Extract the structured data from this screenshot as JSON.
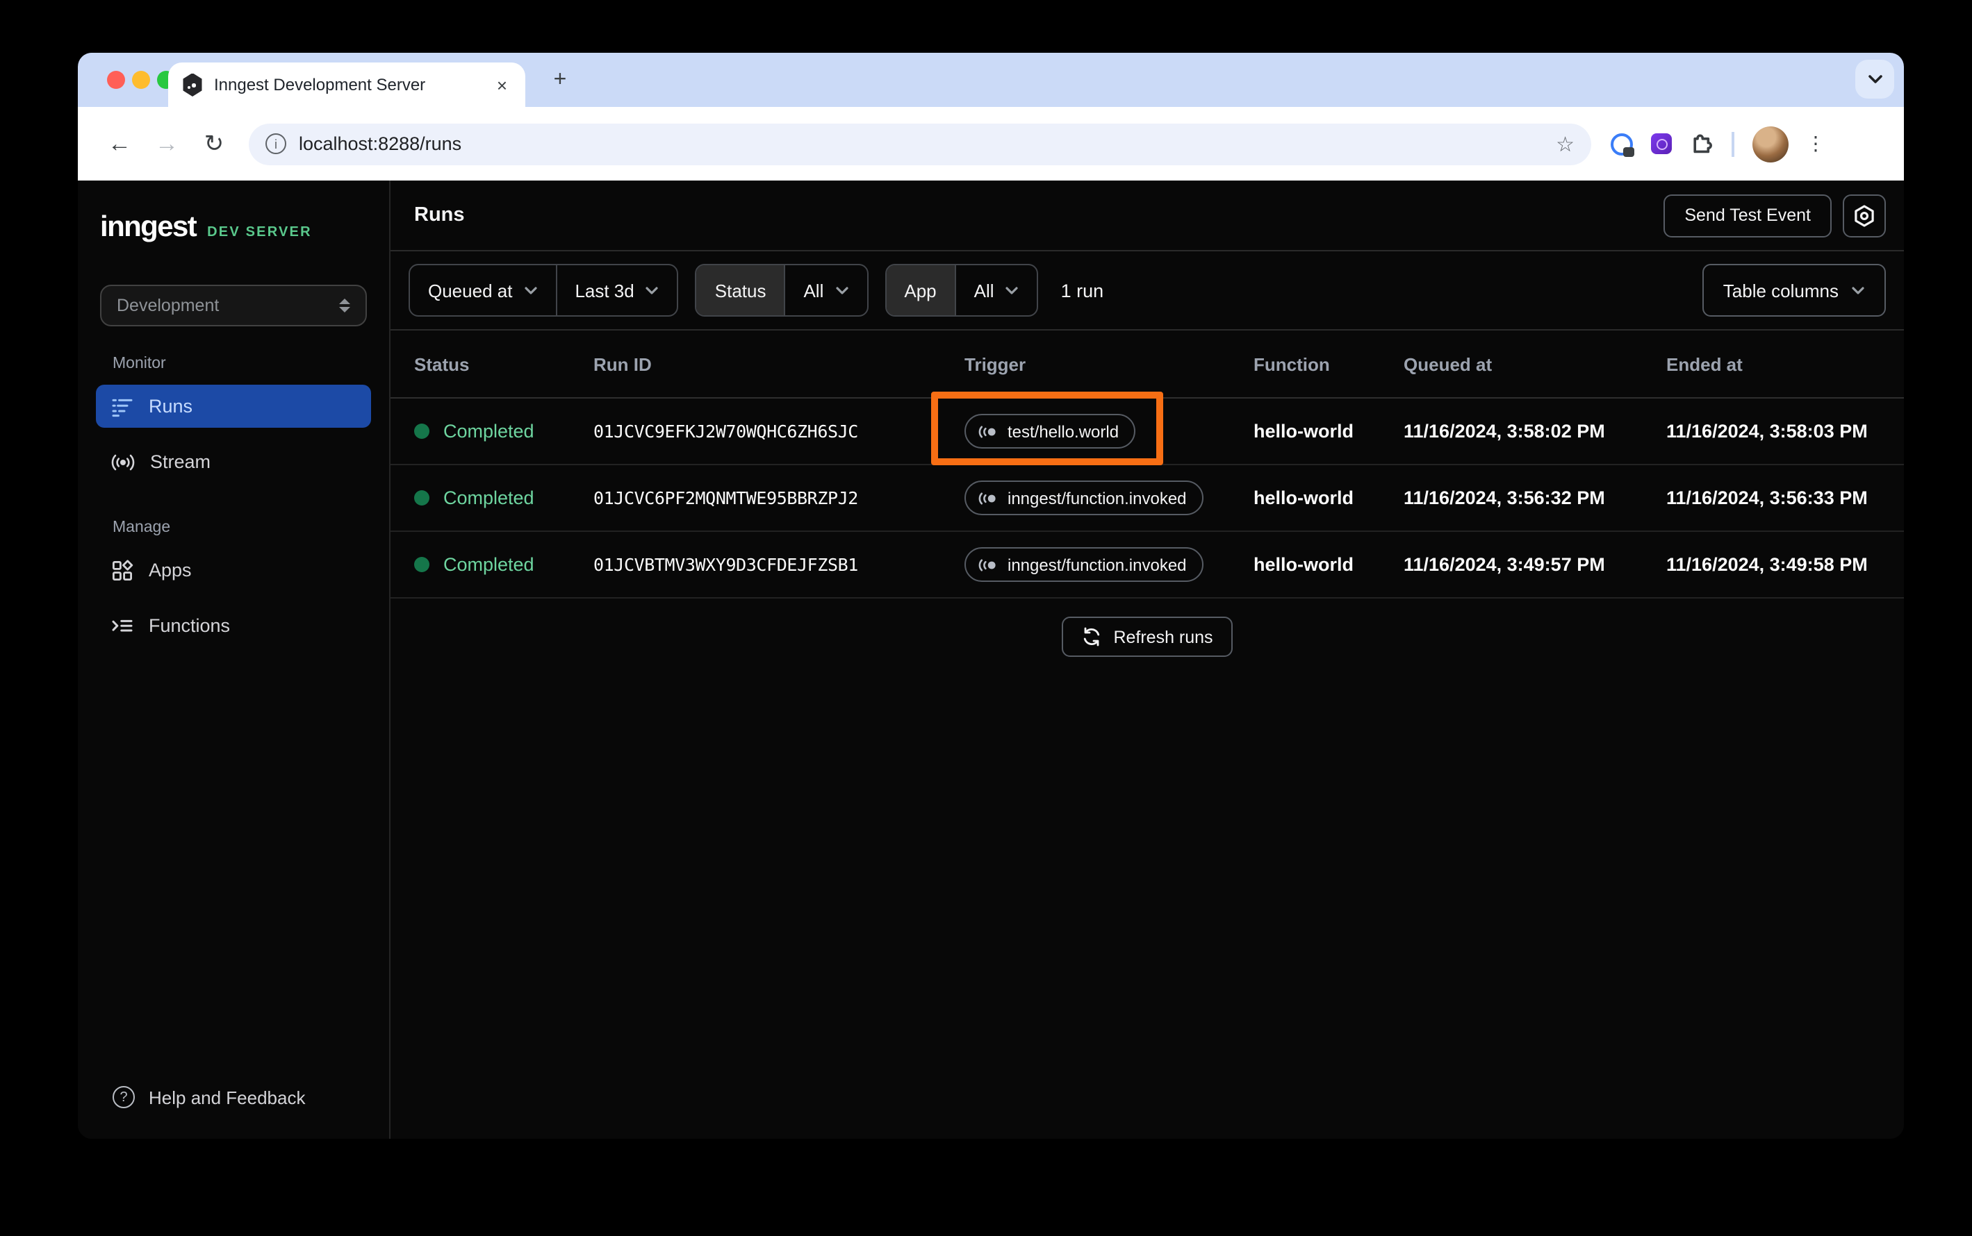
{
  "browser": {
    "tab_title": "Inngest Development Server",
    "close_tab": "×",
    "new_tab": "+",
    "url": "localhost:8288/runs",
    "info_glyph": "i",
    "star_glyph": "☆",
    "back_glyph": "←",
    "forward_glyph": "→",
    "reload_glyph": "↻",
    "menu_glyph": "⋮",
    "help_glyph": "?"
  },
  "sidebar": {
    "logo": "inngest",
    "logo_suffix": "DEV SERVER",
    "env_selector": "Development",
    "monitor_label": "Monitor",
    "manage_label": "Manage",
    "items": {
      "runs": "Runs",
      "stream": "Stream",
      "apps": "Apps",
      "functions": "Functions"
    },
    "help": "Help and Feedback"
  },
  "header": {
    "title": "Runs",
    "send_test_event": "Send Test Event"
  },
  "filters": {
    "queued_at": "Queued at",
    "range": "Last 3d",
    "status_label": "Status",
    "status_value": "All",
    "app_label": "App",
    "app_value": "All",
    "run_count": "1 run",
    "table_columns": "Table columns"
  },
  "table": {
    "columns": [
      "Status",
      "Run ID",
      "Trigger",
      "Function",
      "Queued at",
      "Ended at"
    ],
    "rows": [
      {
        "status": "Completed",
        "run_id": "01JCVC9EFKJ2W70WQHC6ZH6SJC",
        "trigger": "test/hello.world",
        "function": "hello-world",
        "queued_at": "11/16/2024, 3:58:02 PM",
        "ended_at": "11/16/2024, 3:58:03 PM",
        "highlighted": true
      },
      {
        "status": "Completed",
        "run_id": "01JCVC6PF2MQNMTWE95BBRZPJ2",
        "trigger": "inngest/function.invoked",
        "function": "hello-world",
        "queued_at": "11/16/2024, 3:56:32 PM",
        "ended_at": "11/16/2024, 3:56:33 PM",
        "highlighted": false
      },
      {
        "status": "Completed",
        "run_id": "01JCVBTMV3WXY9D3CFDEJFZSB1",
        "trigger": "inngest/function.invoked",
        "function": "hello-world",
        "queued_at": "11/16/2024, 3:49:57 PM",
        "ended_at": "11/16/2024, 3:49:58 PM",
        "highlighted": false
      }
    ],
    "refresh_label": "Refresh runs"
  },
  "colors": {
    "accent_blue": "#1c4aa6",
    "status_green_dot": "#15764a",
    "status_green_text": "#6ed5a0",
    "brand_green": "#5ac88c",
    "highlight_orange": "#f76e14",
    "tabstrip_blue": "#cbdaf7"
  }
}
